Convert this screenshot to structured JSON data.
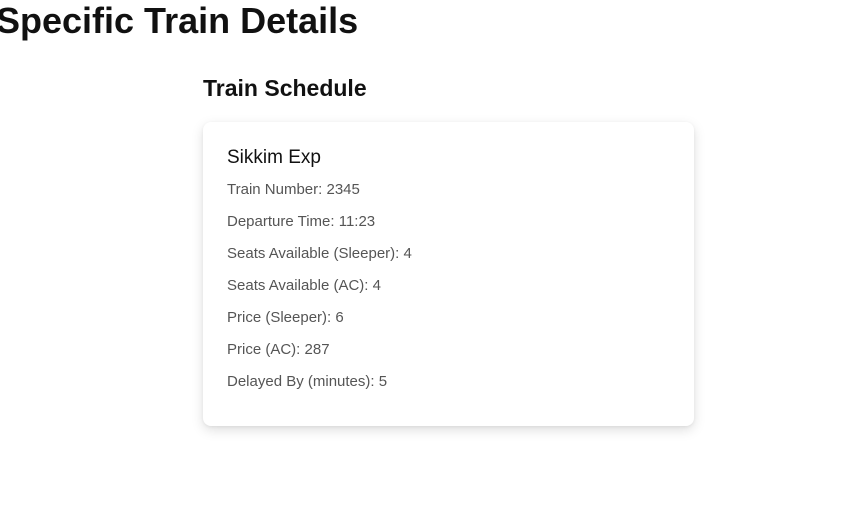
{
  "page": {
    "title": "Specific Train Details",
    "section_title": "Train Schedule"
  },
  "train": {
    "name": "Sikkim Exp",
    "details": [
      {
        "label": "Train Number: 2345"
      },
      {
        "label": "Departure Time: 11:23"
      },
      {
        "label": "Seats Available (Sleeper): 4"
      },
      {
        "label": "Seats Available (AC): 4"
      },
      {
        "label": "Price (Sleeper): 6"
      },
      {
        "label": "Price (AC): 287"
      },
      {
        "label": "Delayed By (minutes): 5"
      }
    ]
  }
}
